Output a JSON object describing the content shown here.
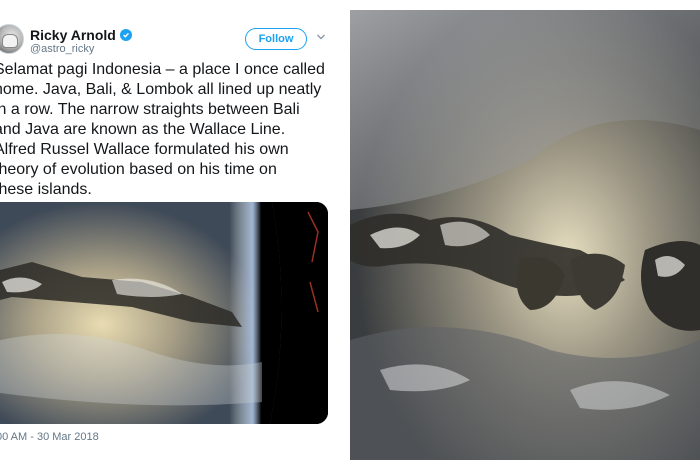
{
  "author": {
    "display_name": "Ricky Arnold",
    "handle": "@astro_ricky",
    "avatar_icon": "astronaut-avatar",
    "verified_icon": "verified-badge-icon"
  },
  "actions": {
    "follow_label": "Follow",
    "more_icon": "chevron-down-icon"
  },
  "tweet": {
    "lines": [
      "Selamat pagi Indonesia – a place I once called",
      "home. Java, Bali, & Lombok all lined up neatly",
      "in a row. The narrow straights between Bali",
      "and Java are known as the Wallace Line.",
      "Alfred Russel Wallace formulated his own",
      "theory of evolution based on his time on",
      "these islands."
    ],
    "timestamp": "00 AM - 30 Mar 2018"
  },
  "colors": {
    "accent": "#1da1f2",
    "text": "#14171a",
    "muted": "#657786"
  }
}
